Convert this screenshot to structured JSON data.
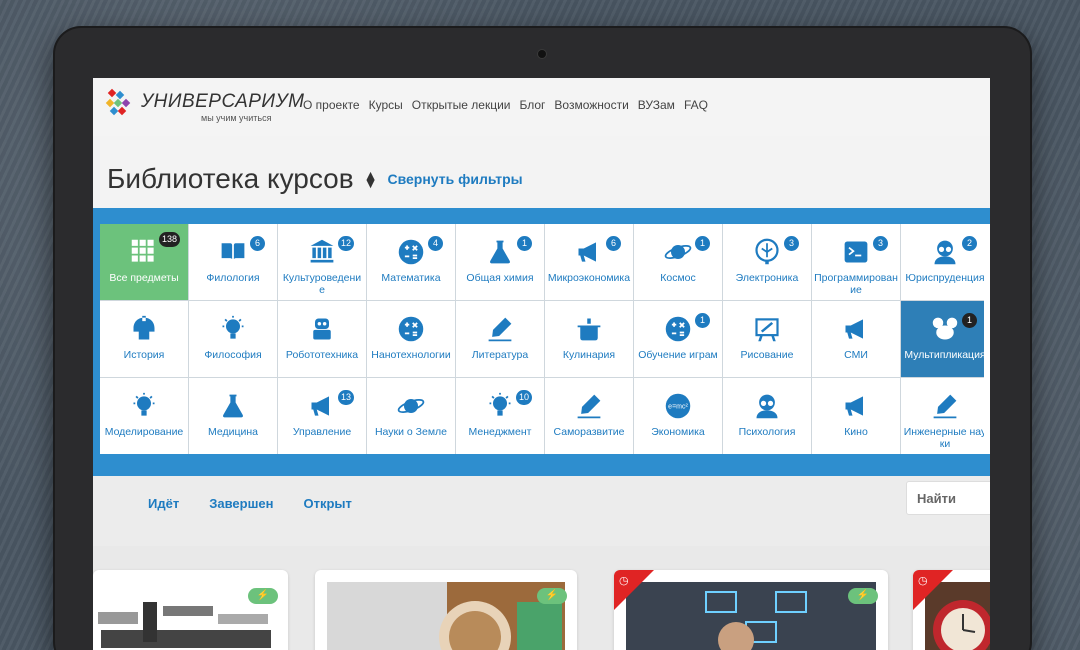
{
  "header": {
    "logo_name": "УНИВЕРСАРИУМ",
    "logo_tagline": "мы учим учиться",
    "nav": [
      "О проекте",
      "Курсы",
      "Открытые лекции",
      "Блог",
      "Возможности",
      "ВУЗам",
      "FAQ"
    ]
  },
  "page": {
    "title": "Библиотека курсов",
    "collapse_filters": "Свернуть фильтры"
  },
  "categories": [
    {
      "label": "Все предметы",
      "count": "138",
      "icon": "grid-icon",
      "state": "green"
    },
    {
      "label": "Филология",
      "count": "6",
      "icon": "book-icon"
    },
    {
      "label": "Культуроведение",
      "count": "12",
      "icon": "museum-icon"
    },
    {
      "label": "Математика",
      "count": "4",
      "icon": "math-symbols-icon"
    },
    {
      "label": "Общая химия",
      "count": "1",
      "icon": "flask-icon"
    },
    {
      "label": "Микроэкономика",
      "count": "6",
      "icon": "megaphone-icon"
    },
    {
      "label": "Космос",
      "count": "1",
      "icon": "planet-icon"
    },
    {
      "label": "Электроника",
      "count": "3",
      "icon": "circuit-icon"
    },
    {
      "label": "Программирование",
      "count": "3",
      "icon": "terminal-icon"
    },
    {
      "label": "Юриспруденция",
      "count": "2",
      "icon": "person-glasses-icon"
    },
    {
      "label": "История",
      "count": "",
      "icon": "helmet-icon"
    },
    {
      "label": "Философия",
      "count": "",
      "icon": "lightbulb-icon"
    },
    {
      "label": "Робототехника",
      "count": "",
      "icon": "robot-icon"
    },
    {
      "label": "Нанотехнологии",
      "count": "",
      "icon": "math-symbols-icon"
    },
    {
      "label": "Литература",
      "count": "",
      "icon": "pen-icon"
    },
    {
      "label": "Кулинария",
      "count": "",
      "icon": "pot-icon"
    },
    {
      "label": "Обучение играм",
      "count": "1",
      "icon": "math-symbols-icon"
    },
    {
      "label": "Рисование",
      "count": "",
      "icon": "easel-icon"
    },
    {
      "label": "СМИ",
      "count": "",
      "icon": "megaphone-icon"
    },
    {
      "label": "Мультипликация",
      "count": "1",
      "icon": "mouse-ears-icon",
      "state": "blue"
    },
    {
      "label": "Моделирование",
      "count": "",
      "icon": "lightbulb-icon"
    },
    {
      "label": "Медицина",
      "count": "",
      "icon": "flask-icon"
    },
    {
      "label": "Управление",
      "count": "13",
      "icon": "megaphone-icon"
    },
    {
      "label": "Науки о Земле",
      "count": "",
      "icon": "planet-icon"
    },
    {
      "label": "Менеджмент",
      "count": "10",
      "icon": "lightbulb-icon"
    },
    {
      "label": "Саморазвитие",
      "count": "",
      "icon": "pen-icon"
    },
    {
      "label": "Экономика",
      "count": "",
      "icon": "e-mc2-icon"
    },
    {
      "label": "Психология",
      "count": "",
      "icon": "person-glasses-icon"
    },
    {
      "label": "Кино",
      "count": "",
      "icon": "megaphone-icon"
    },
    {
      "label": "Инженерные науки",
      "count": "",
      "icon": "pen-icon"
    }
  ],
  "filters": [
    "Идёт",
    "Завершен",
    "Открыт"
  ],
  "search": {
    "label": "Найти"
  },
  "colors": {
    "accent": "#1e7bc0",
    "panel": "#2e8ecf",
    "green": "#6cc27c",
    "red": "#e02424"
  }
}
